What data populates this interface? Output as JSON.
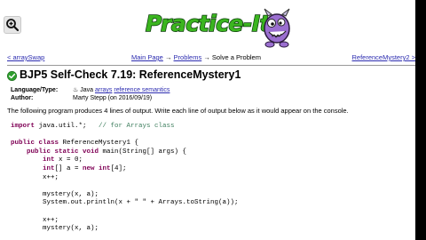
{
  "header": {
    "logo_text": "Practice-It!",
    "mascot_icon": "purple-monster-mascot-icon"
  },
  "nav": {
    "prev": "< arraySwap",
    "crumb_main": "Main Page",
    "crumb_problems": "Problems",
    "arrow": "→",
    "crumb_current": "Solve a Problem",
    "next": "ReferenceMystery2 >"
  },
  "problem": {
    "title": "BJP5 Self-Check 7.19: ReferenceMystery1",
    "status_icon": "green-checkmark-icon",
    "language_label": "Language/Type:",
    "language_value": "Java",
    "tag_1": "arrays",
    "tag_2": "reference semantics",
    "author_label": "Author:",
    "author_value": "Marty Stepp (on 2016/09/19)",
    "description": "The following program produces 4 lines of output. Write each line of output below as it would appear on the console."
  },
  "code_lines": [
    {
      "kw": "import",
      "text": " java.util.*;   ",
      "comment": "// for Arrays class"
    },
    {
      "kw": "",
      "text": "",
      "comment": ""
    },
    {
      "kw": "public class",
      "text": " ReferenceMystery1 {",
      "comment": ""
    },
    {
      "kw": "    public static void",
      "text": " main(String[] args) {",
      "comment": ""
    },
    {
      "kw": "        int",
      "text": " x = 0;",
      "comment": ""
    },
    {
      "kw": "        int",
      "text": "[] a = ",
      "kw2": "new int",
      "text2": "[4];",
      "comment": ""
    },
    {
      "kw": "",
      "text": "        x++;",
      "comment": ""
    },
    {
      "kw": "",
      "text": "",
      "comment": ""
    },
    {
      "kw": "",
      "text": "        mystery(x, a);",
      "comment": ""
    },
    {
      "kw": "",
      "text": "        System.out.println(x + \" \" + Arrays.toString(a));",
      "comment": ""
    },
    {
      "kw": "",
      "text": "",
      "comment": ""
    },
    {
      "kw": "",
      "text": "        x++;",
      "comment": ""
    },
    {
      "kw": "",
      "text": "        mystery(x, a);",
      "comment": ""
    }
  ],
  "colors": {
    "link": "#2c2cb0",
    "logo_green": "#3bb51f",
    "check_green": "#2e9e2e",
    "keyword": "#7f0055",
    "comment": "#3f7f5f"
  }
}
